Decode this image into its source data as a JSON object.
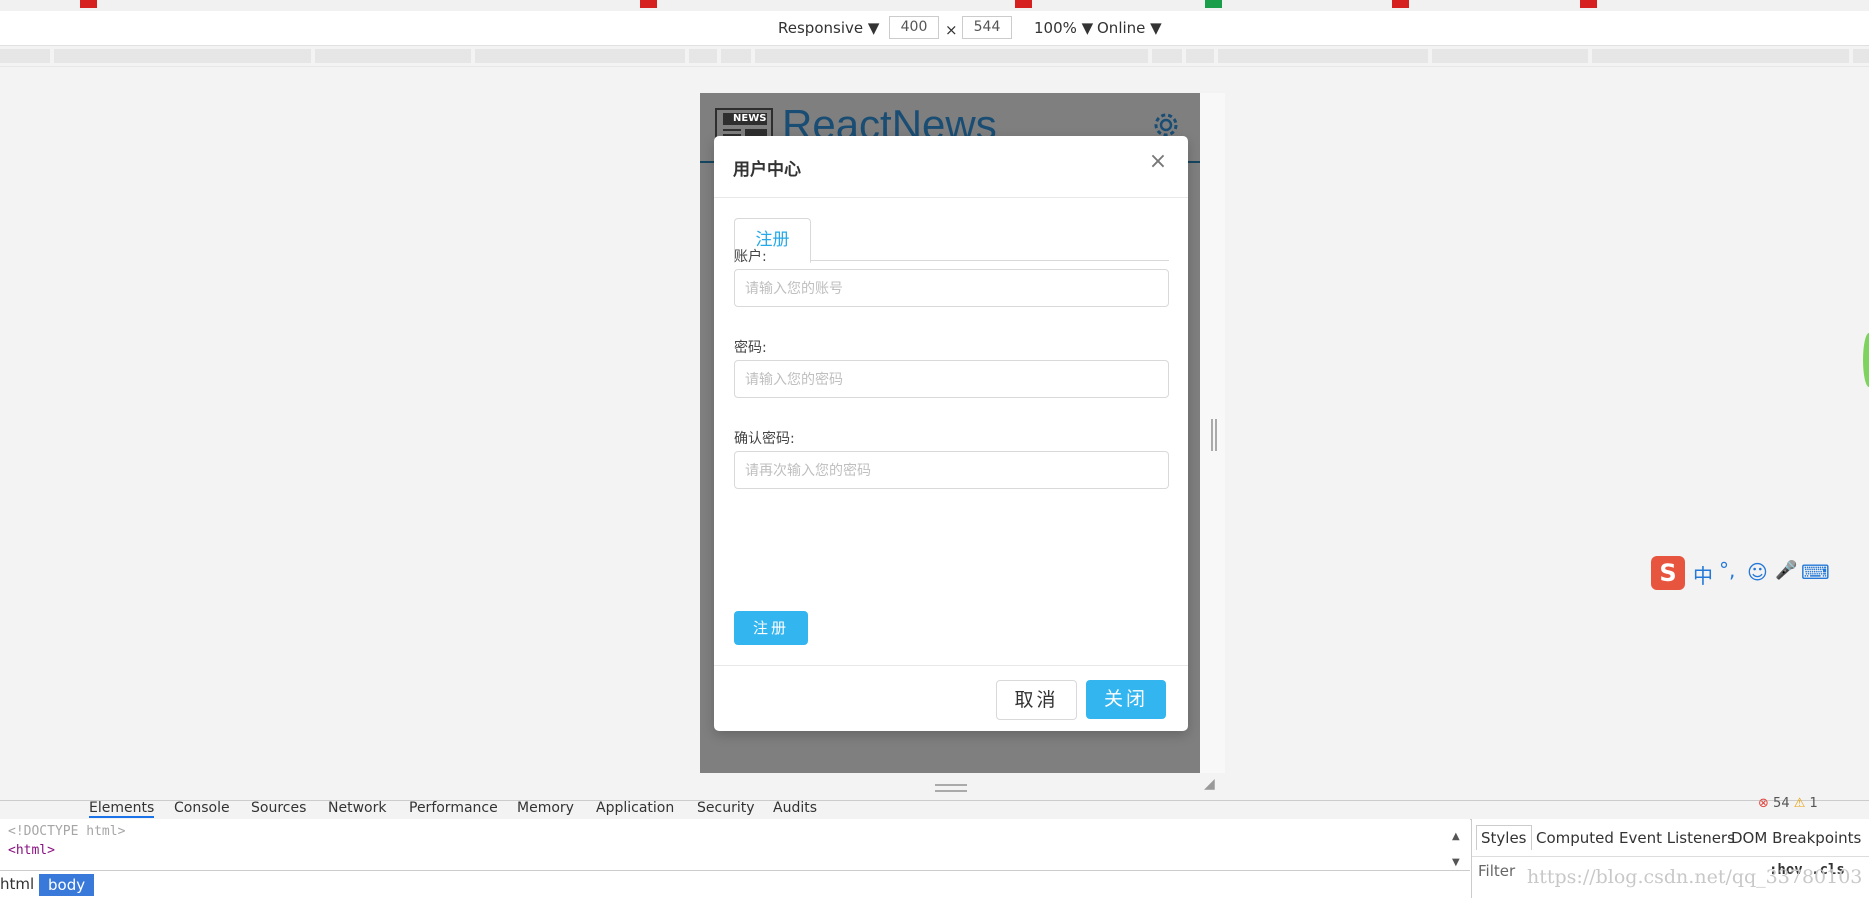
{
  "device_toolbar": {
    "mode": "Responsive ▼",
    "width": "400",
    "times": "×",
    "height": "544",
    "zoom": "100% ▼",
    "network": "Online ▼"
  },
  "app": {
    "logo_badge": "NEWS",
    "brand": "ReactNews",
    "settings_icon": "gear-icon",
    "brand_color": "#1a4d73"
  },
  "modal": {
    "title": "用户中心",
    "close": "×",
    "tab": "注册",
    "fields": [
      {
        "label": "账户:",
        "placeholder": "请输入您的账号"
      },
      {
        "label": "密码:",
        "placeholder": "请输入您的密码"
      },
      {
        "label": "确认密码:",
        "placeholder": "请再次输入您的密码"
      }
    ],
    "submit": "注册",
    "cancel": "取消",
    "ok": "关闭",
    "accent": "#33b5f0"
  },
  "ime": {
    "mode": "中",
    "punct": "°,",
    "smile": "☺",
    "mic": "🎤",
    "keyboard": "⌨"
  },
  "devtools": {
    "tabs": [
      "Elements",
      "Console",
      "Sources",
      "Network",
      "Performance",
      "Memory",
      "Application",
      "Security",
      "Audits"
    ],
    "error_count": "54",
    "warn_count": "1",
    "code_lines": [
      "<!DOCTYPE html>",
      "<html>"
    ],
    "breadcrumbs": [
      "html",
      "body"
    ],
    "side_tabs": [
      "Styles",
      "Computed",
      "Event Listeners",
      "DOM Breakpoints"
    ],
    "filter_placeholder": "Filter",
    "hov_cls": ":hov .cls",
    "watermark": "https://blog.csdn.net/qq_33780103"
  }
}
